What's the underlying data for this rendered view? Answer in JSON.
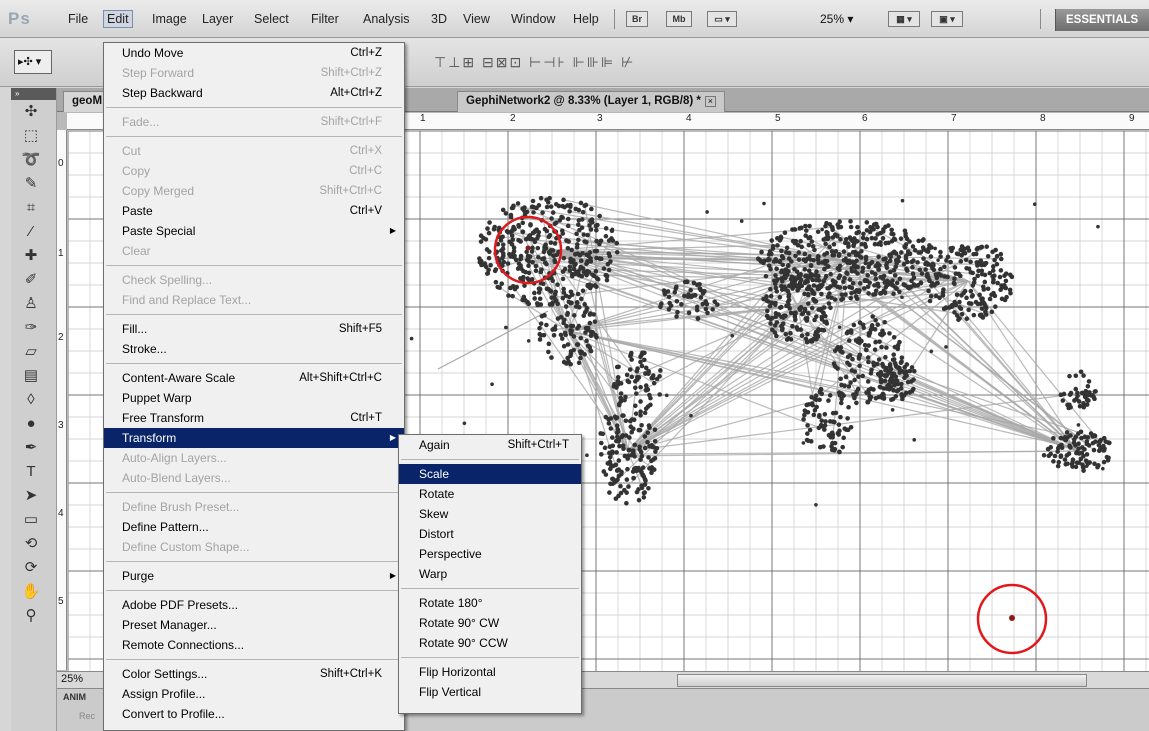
{
  "app": {
    "logo": "Ps",
    "menus": [
      "File",
      "Edit",
      "Image",
      "Layer",
      "Select",
      "Filter",
      "Analysis",
      "3D",
      "View",
      "Window",
      "Help"
    ],
    "buttons": {
      "bridge": "Br",
      "mini_bridge": "Mb"
    },
    "zoom": "25%",
    "workspace": "ESSENTIALS"
  },
  "document": {
    "tab_left": "geoM",
    "tab_left_suffix": ") *",
    "tab_right": "GephiNetwork2 @ 8.33% (Layer 1, RGB/8) *",
    "ruler_h": [
      "1",
      "2",
      "3",
      "4",
      "5",
      "6",
      "7",
      "8",
      "9"
    ],
    "ruler_v": [
      "0",
      "1",
      "2",
      "3",
      "4",
      "5"
    ],
    "zoom_status": "25%",
    "panel_tab": "ANIM",
    "panel_label": "Rec"
  },
  "edit_menu": [
    {
      "label": "Undo Move",
      "shortcut": "Ctrl+Z",
      "enabled": true
    },
    {
      "label": "Step Forward",
      "shortcut": "Shift+Ctrl+Z",
      "enabled": false
    },
    {
      "label": "Step Backward",
      "shortcut": "Alt+Ctrl+Z",
      "enabled": true
    },
    {
      "sep": true
    },
    {
      "label": "Fade...",
      "shortcut": "Shift+Ctrl+F",
      "enabled": false
    },
    {
      "sep": true
    },
    {
      "label": "Cut",
      "shortcut": "Ctrl+X",
      "enabled": false
    },
    {
      "label": "Copy",
      "shortcut": "Ctrl+C",
      "enabled": false
    },
    {
      "label": "Copy Merged",
      "shortcut": "Shift+Ctrl+C",
      "enabled": false
    },
    {
      "label": "Paste",
      "shortcut": "Ctrl+V",
      "enabled": true
    },
    {
      "label": "Paste Special",
      "shortcut": "",
      "enabled": true,
      "submenu": true
    },
    {
      "label": "Clear",
      "shortcut": "",
      "enabled": false
    },
    {
      "sep": true
    },
    {
      "label": "Check Spelling...",
      "shortcut": "",
      "enabled": false
    },
    {
      "label": "Find and Replace Text...",
      "shortcut": "",
      "enabled": false
    },
    {
      "sep": true
    },
    {
      "label": "Fill...",
      "shortcut": "Shift+F5",
      "enabled": true
    },
    {
      "label": "Stroke...",
      "shortcut": "",
      "enabled": true
    },
    {
      "sep": true
    },
    {
      "label": "Content-Aware Scale",
      "shortcut": "Alt+Shift+Ctrl+C",
      "enabled": true
    },
    {
      "label": "Puppet Warp",
      "shortcut": "",
      "enabled": true
    },
    {
      "label": "Free Transform",
      "shortcut": "Ctrl+T",
      "enabled": true
    },
    {
      "label": "Transform",
      "shortcut": "",
      "enabled": true,
      "submenu": true,
      "highlight": true
    },
    {
      "label": "Auto-Align Layers...",
      "shortcut": "",
      "enabled": false
    },
    {
      "label": "Auto-Blend Layers...",
      "shortcut": "",
      "enabled": false
    },
    {
      "sep": true
    },
    {
      "label": "Define Brush Preset...",
      "shortcut": "",
      "enabled": false
    },
    {
      "label": "Define Pattern...",
      "shortcut": "",
      "enabled": true
    },
    {
      "label": "Define Custom Shape...",
      "shortcut": "",
      "enabled": false
    },
    {
      "sep": true
    },
    {
      "label": "Purge",
      "shortcut": "",
      "enabled": true,
      "submenu": true
    },
    {
      "sep": true
    },
    {
      "label": "Adobe PDF Presets...",
      "shortcut": "",
      "enabled": true
    },
    {
      "label": "Preset Manager...",
      "shortcut": "",
      "enabled": true
    },
    {
      "label": "Remote Connections...",
      "shortcut": "",
      "enabled": true
    },
    {
      "sep": true
    },
    {
      "label": "Color Settings...",
      "shortcut": "Shift+Ctrl+K",
      "enabled": true
    },
    {
      "label": "Assign Profile...",
      "shortcut": "",
      "enabled": true
    },
    {
      "label": "Convert to Profile...",
      "shortcut": "",
      "enabled": true
    }
  ],
  "transform_menu": [
    {
      "label": "Again",
      "shortcut": "Shift+Ctrl+T",
      "enabled": true
    },
    {
      "sep": true
    },
    {
      "label": "Scale",
      "shortcut": "",
      "enabled": true,
      "highlight": true
    },
    {
      "label": "Rotate",
      "shortcut": "",
      "enabled": true
    },
    {
      "label": "Skew",
      "shortcut": "",
      "enabled": true
    },
    {
      "label": "Distort",
      "shortcut": "",
      "enabled": true
    },
    {
      "label": "Perspective",
      "shortcut": "",
      "enabled": true
    },
    {
      "label": "Warp",
      "shortcut": "",
      "enabled": true
    },
    {
      "sep": true
    },
    {
      "label": "Rotate 180°",
      "shortcut": "",
      "enabled": true
    },
    {
      "label": "Rotate 90° CW",
      "shortcut": "",
      "enabled": true
    },
    {
      "label": "Rotate 90° CCW",
      "shortcut": "",
      "enabled": true
    },
    {
      "sep": true
    },
    {
      "label": "Flip Horizontal",
      "shortcut": "",
      "enabled": true
    },
    {
      "label": "Flip Vertical",
      "shortcut": "",
      "enabled": true
    }
  ],
  "tools": [
    "move-icon",
    "marquee-icon",
    "lasso-icon",
    "quick-select-icon",
    "crop-icon",
    "eyedropper-icon",
    "healing-brush-icon",
    "brush-icon",
    "clone-stamp-icon",
    "history-brush-icon",
    "eraser-icon",
    "gradient-icon",
    "blur-icon",
    "dodge-icon",
    "pen-icon",
    "type-icon",
    "path-select-icon",
    "shape-icon",
    "3d-rotate-icon",
    "3d-orbit-icon",
    "hand-icon",
    "zoom-icon"
  ],
  "colors": {
    "menu_highlight": "#0a246a",
    "annotation_circle": "#e0191d",
    "node": "#333333",
    "edge": "#a8a8a8"
  }
}
